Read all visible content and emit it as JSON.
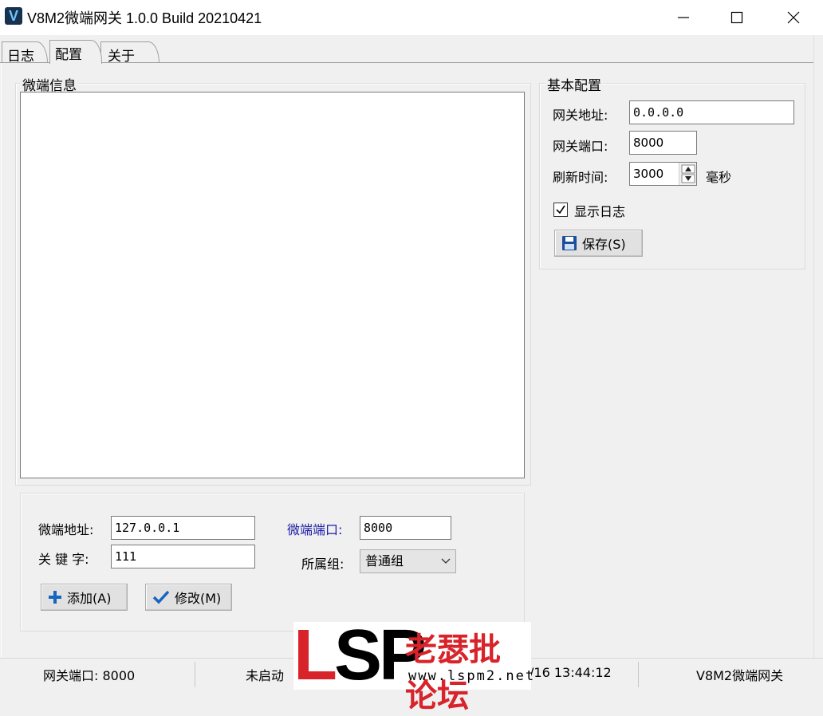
{
  "window": {
    "title": "V8M2微端网关 1.0.0 Build 20210421",
    "icon_letter": "V"
  },
  "tabs": [
    {
      "label": "日志",
      "active": false
    },
    {
      "label": "配置",
      "active": true
    },
    {
      "label": "关于",
      "active": false
    }
  ],
  "micro_info": {
    "group_title": "微端信息",
    "address_label": "微端地址:",
    "address_value": "127.0.0.1",
    "port_label": "微端端口:",
    "port_value": "8000",
    "keyword_label": "关 键 字:",
    "keyword_value": "111",
    "group_label": "所属组:",
    "group_value": "普通组",
    "add_button": "添加(A)",
    "modify_button": "修改(M)"
  },
  "basic_config": {
    "group_title": "基本配置",
    "gateway_address_label": "网关地址:",
    "gateway_address_value": "0.0.0.0",
    "gateway_port_label": "网关端口:",
    "gateway_port_value": "8000",
    "refresh_label": "刷新时间:",
    "refresh_value": "3000",
    "refresh_unit": "毫秒",
    "show_log_label": "显示日志",
    "show_log_checked": true,
    "save_button": "保存(S)"
  },
  "status_bar": {
    "port": "网关端口: 8000",
    "state": "未启动",
    "time": "/16 13:44:12",
    "app": "V8M2微端网关"
  },
  "watermark": {
    "logo": "LSP",
    "text": "老瑟批论坛",
    "url": "www.lspm2.net"
  },
  "colors": {
    "accent_label": "#1a1aa6",
    "add_icon": "#1565c0",
    "check_icon": "#1565c0"
  }
}
